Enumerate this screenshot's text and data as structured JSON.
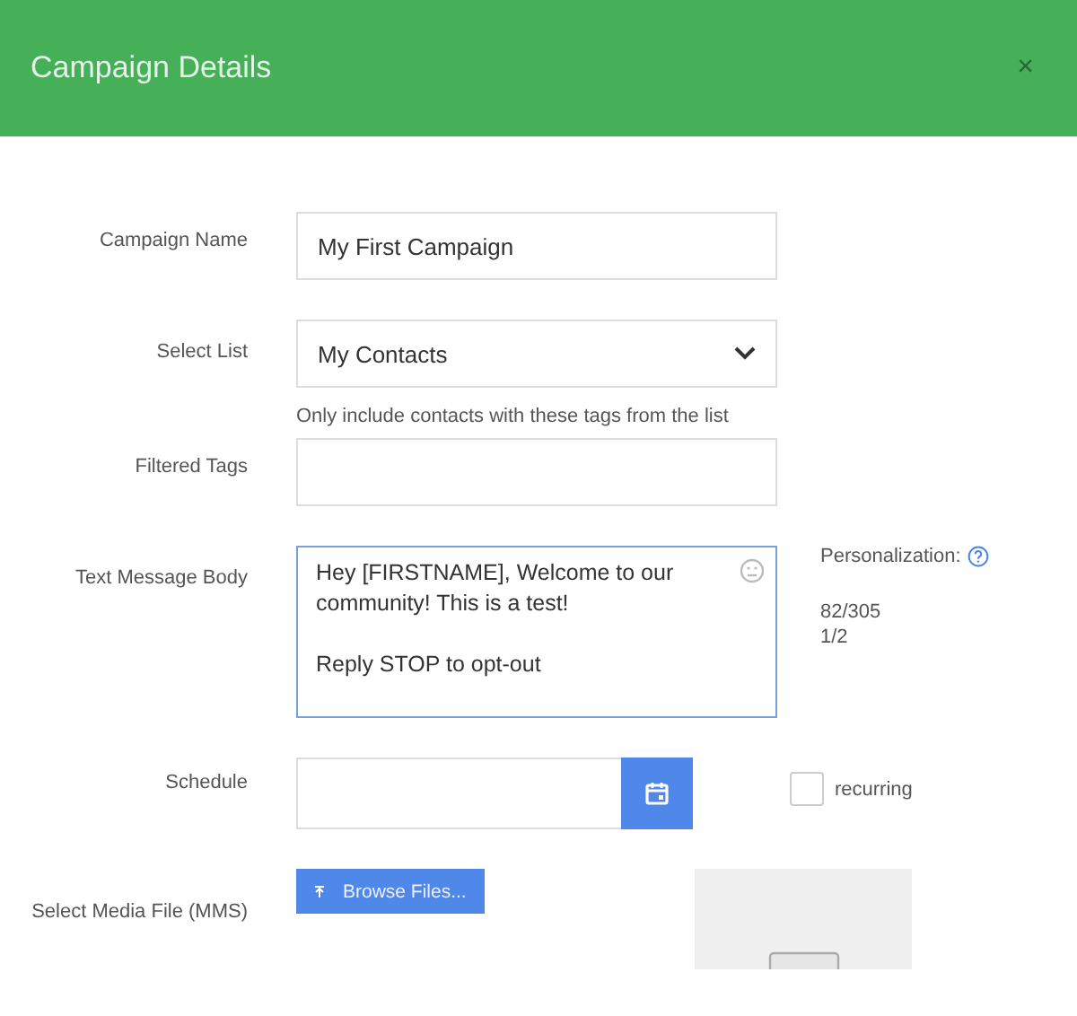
{
  "window": {
    "title": "Campaign Details",
    "close": "×"
  },
  "fields": [
    {
      "kind": "text",
      "label": "Campaign Name",
      "value": "My First Campaign"
    },
    {
      "kind": "select",
      "label": "Select List",
      "value": "My Contacts"
    },
    {
      "kind": "text",
      "label": "Filtered Tags",
      "hint": "Only include contacts with these tags from the list"
    },
    {
      "kind": "message",
      "label": "Text Message Body",
      "value": "Hey [FIRSTNAME], Welcome to our community! This is a test!\n\nReply STOP to opt-out",
      "personalization": "Personalization:",
      "counts": [
        "82/305",
        "1/2"
      ]
    },
    {
      "kind": "date",
      "label": "Schedule",
      "recurring": {
        "label": "recurring",
        "checked": false
      }
    },
    {
      "kind": "file",
      "label": "Select Media File (MMS)",
      "button": "Browse Files..."
    }
  ]
}
